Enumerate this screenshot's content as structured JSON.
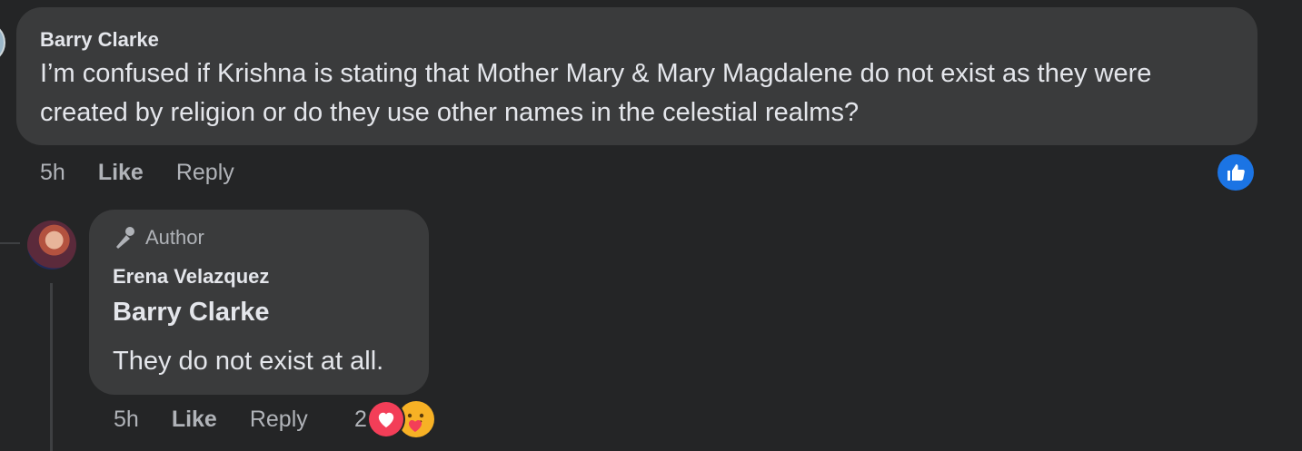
{
  "comment": {
    "author": "Barry Clarke",
    "text": "I’m confused if Krishna is stating that Mother Mary & Mary Magdalene do not exist as they were created by religion or do they use other names in the celestial realms?",
    "time": "5h",
    "like_label": "Like",
    "reply_label": "Reply",
    "reaction_icon": "like-icon"
  },
  "reply": {
    "badge": "Author",
    "author": "Erena Velazquez",
    "mention": "Barry Clarke",
    "text": "They do not exist at all.",
    "time": "5h",
    "like_label": "Like",
    "reply_label": "Reply",
    "reaction_count": "2",
    "reaction_icons": [
      "heart-icon",
      "care-icon"
    ]
  },
  "colors": {
    "background": "#242526",
    "bubble": "#3a3b3c",
    "like_blue": "#1b74e4",
    "heart_red": "#f33e58",
    "care_yellow": "#f7b125"
  }
}
